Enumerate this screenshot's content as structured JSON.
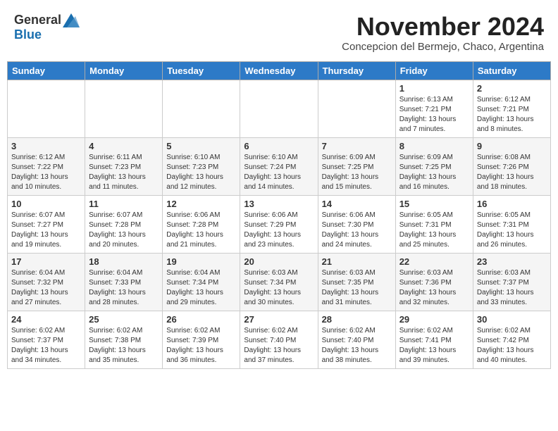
{
  "logo": {
    "general": "General",
    "blue": "Blue"
  },
  "title": "November 2024",
  "subtitle": "Concepcion del Bermejo, Chaco, Argentina",
  "headers": [
    "Sunday",
    "Monday",
    "Tuesday",
    "Wednesday",
    "Thursday",
    "Friday",
    "Saturday"
  ],
  "weeks": [
    [
      {
        "day": "",
        "info": ""
      },
      {
        "day": "",
        "info": ""
      },
      {
        "day": "",
        "info": ""
      },
      {
        "day": "",
        "info": ""
      },
      {
        "day": "",
        "info": ""
      },
      {
        "day": "1",
        "info": "Sunrise: 6:13 AM\nSunset: 7:21 PM\nDaylight: 13 hours\nand 7 minutes."
      },
      {
        "day": "2",
        "info": "Sunrise: 6:12 AM\nSunset: 7:21 PM\nDaylight: 13 hours\nand 8 minutes."
      }
    ],
    [
      {
        "day": "3",
        "info": "Sunrise: 6:12 AM\nSunset: 7:22 PM\nDaylight: 13 hours\nand 10 minutes."
      },
      {
        "day": "4",
        "info": "Sunrise: 6:11 AM\nSunset: 7:23 PM\nDaylight: 13 hours\nand 11 minutes."
      },
      {
        "day": "5",
        "info": "Sunrise: 6:10 AM\nSunset: 7:23 PM\nDaylight: 13 hours\nand 12 minutes."
      },
      {
        "day": "6",
        "info": "Sunrise: 6:10 AM\nSunset: 7:24 PM\nDaylight: 13 hours\nand 14 minutes."
      },
      {
        "day": "7",
        "info": "Sunrise: 6:09 AM\nSunset: 7:25 PM\nDaylight: 13 hours\nand 15 minutes."
      },
      {
        "day": "8",
        "info": "Sunrise: 6:09 AM\nSunset: 7:25 PM\nDaylight: 13 hours\nand 16 minutes."
      },
      {
        "day": "9",
        "info": "Sunrise: 6:08 AM\nSunset: 7:26 PM\nDaylight: 13 hours\nand 18 minutes."
      }
    ],
    [
      {
        "day": "10",
        "info": "Sunrise: 6:07 AM\nSunset: 7:27 PM\nDaylight: 13 hours\nand 19 minutes."
      },
      {
        "day": "11",
        "info": "Sunrise: 6:07 AM\nSunset: 7:28 PM\nDaylight: 13 hours\nand 20 minutes."
      },
      {
        "day": "12",
        "info": "Sunrise: 6:06 AM\nSunset: 7:28 PM\nDaylight: 13 hours\nand 21 minutes."
      },
      {
        "day": "13",
        "info": "Sunrise: 6:06 AM\nSunset: 7:29 PM\nDaylight: 13 hours\nand 23 minutes."
      },
      {
        "day": "14",
        "info": "Sunrise: 6:06 AM\nSunset: 7:30 PM\nDaylight: 13 hours\nand 24 minutes."
      },
      {
        "day": "15",
        "info": "Sunrise: 6:05 AM\nSunset: 7:31 PM\nDaylight: 13 hours\nand 25 minutes."
      },
      {
        "day": "16",
        "info": "Sunrise: 6:05 AM\nSunset: 7:31 PM\nDaylight: 13 hours\nand 26 minutes."
      }
    ],
    [
      {
        "day": "17",
        "info": "Sunrise: 6:04 AM\nSunset: 7:32 PM\nDaylight: 13 hours\nand 27 minutes."
      },
      {
        "day": "18",
        "info": "Sunrise: 6:04 AM\nSunset: 7:33 PM\nDaylight: 13 hours\nand 28 minutes."
      },
      {
        "day": "19",
        "info": "Sunrise: 6:04 AM\nSunset: 7:34 PM\nDaylight: 13 hours\nand 29 minutes."
      },
      {
        "day": "20",
        "info": "Sunrise: 6:03 AM\nSunset: 7:34 PM\nDaylight: 13 hours\nand 30 minutes."
      },
      {
        "day": "21",
        "info": "Sunrise: 6:03 AM\nSunset: 7:35 PM\nDaylight: 13 hours\nand 31 minutes."
      },
      {
        "day": "22",
        "info": "Sunrise: 6:03 AM\nSunset: 7:36 PM\nDaylight: 13 hours\nand 32 minutes."
      },
      {
        "day": "23",
        "info": "Sunrise: 6:03 AM\nSunset: 7:37 PM\nDaylight: 13 hours\nand 33 minutes."
      }
    ],
    [
      {
        "day": "24",
        "info": "Sunrise: 6:02 AM\nSunset: 7:37 PM\nDaylight: 13 hours\nand 34 minutes."
      },
      {
        "day": "25",
        "info": "Sunrise: 6:02 AM\nSunset: 7:38 PM\nDaylight: 13 hours\nand 35 minutes."
      },
      {
        "day": "26",
        "info": "Sunrise: 6:02 AM\nSunset: 7:39 PM\nDaylight: 13 hours\nand 36 minutes."
      },
      {
        "day": "27",
        "info": "Sunrise: 6:02 AM\nSunset: 7:40 PM\nDaylight: 13 hours\nand 37 minutes."
      },
      {
        "day": "28",
        "info": "Sunrise: 6:02 AM\nSunset: 7:40 PM\nDaylight: 13 hours\nand 38 minutes."
      },
      {
        "day": "29",
        "info": "Sunrise: 6:02 AM\nSunset: 7:41 PM\nDaylight: 13 hours\nand 39 minutes."
      },
      {
        "day": "30",
        "info": "Sunrise: 6:02 AM\nSunset: 7:42 PM\nDaylight: 13 hours\nand 40 minutes."
      }
    ]
  ]
}
